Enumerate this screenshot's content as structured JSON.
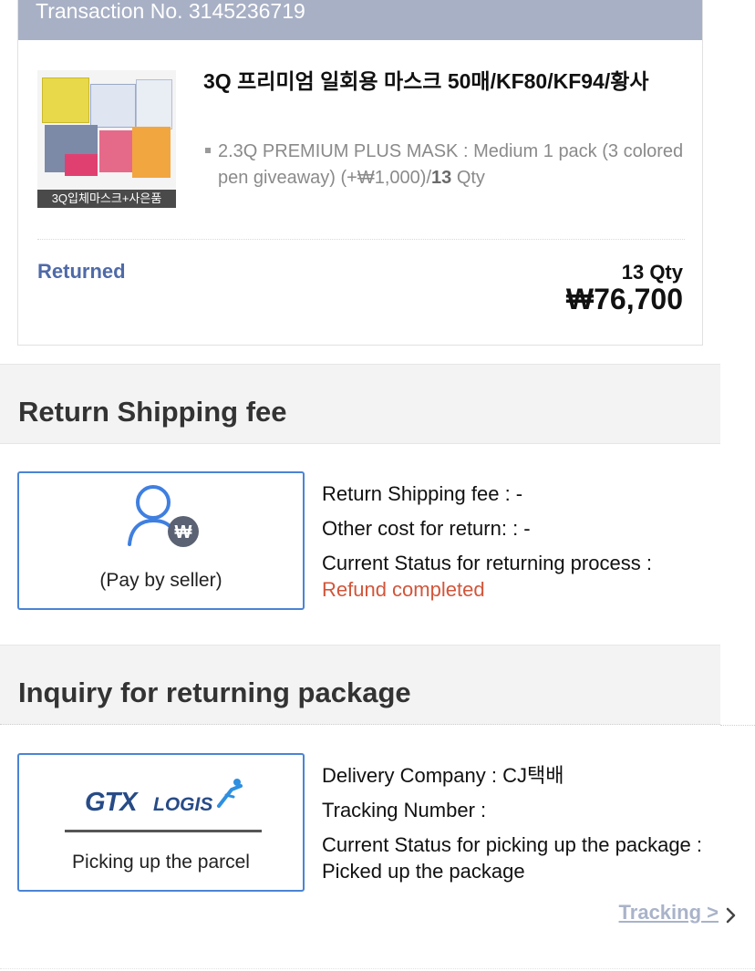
{
  "order": {
    "transaction_label": "Transaction No. 3145236719",
    "product_title": "3Q 프리미엄 일회용 마스크 50매/KF80/KF94/황사",
    "thumbnail_caption": "3Q입체마스크+사은품",
    "option_text": "2.3Q PREMIUM PLUS MASK : Medium 1 pack (3 colored pen giveaway) (+₩1,000)/",
    "option_qty_number": "13",
    "option_qty_unit": " Qty",
    "status": "Returned",
    "qty": "13 Qty",
    "price": "₩76,700"
  },
  "return_fee_section": {
    "heading": "Return Shipping fee",
    "box_label": "(Pay by seller)",
    "lines": {
      "fee": "Return Shipping fee : -",
      "other_cost": "Other cost for return: : -",
      "status_label": "Current Status for returning process :",
      "status_value": "Refund completed"
    },
    "icon": "person-won-icon"
  },
  "package_section": {
    "heading": "Inquiry for returning package",
    "logo_text_main": "GTX",
    "logo_text_sub": "LOGIS",
    "box_label": "Picking up the parcel",
    "lines": {
      "company": "Delivery Company : CJ택배",
      "tracking_number": "Tracking Number :",
      "status": "Current Status for picking up the package : Picked up the package"
    },
    "tracking_link": "Tracking >"
  },
  "colors": {
    "header_bg": "#a8b0c5",
    "accent_blue": "#4a84d4",
    "status_blue": "#4f6aa8",
    "refund_red": "#d2553a",
    "link_gray": "#a9b3c9"
  }
}
